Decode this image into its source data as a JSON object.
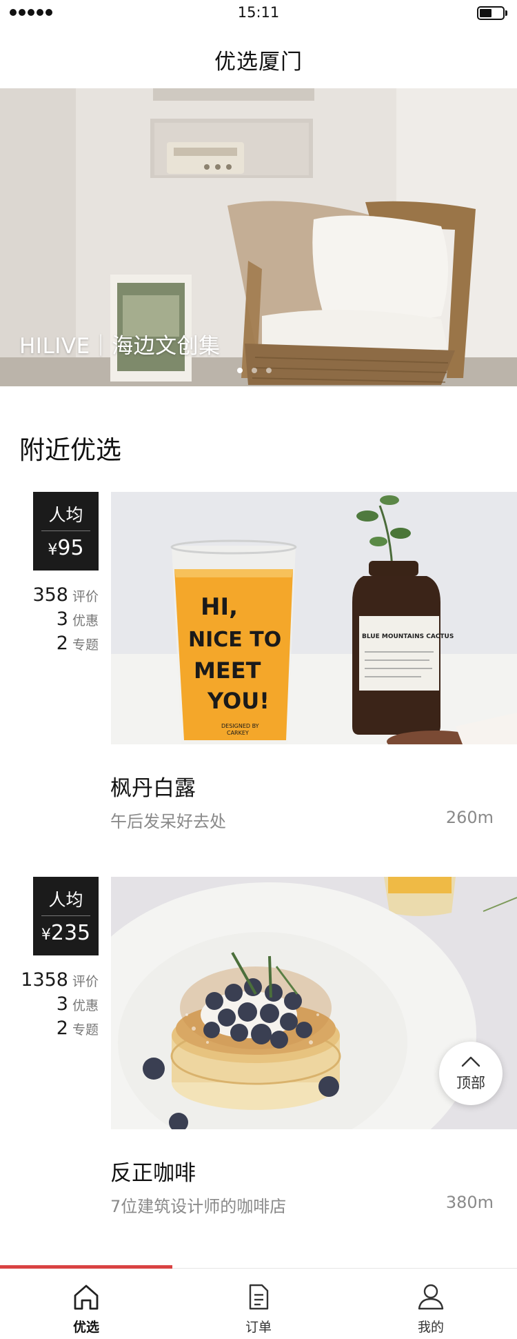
{
  "status_bar": {
    "time": "15:11"
  },
  "nav": {
    "title": "优选厦门"
  },
  "banner": {
    "caption": "HILIVE｜海边文创集",
    "slide_count": 3,
    "active_slide": 1
  },
  "section": {
    "title": "附近优选"
  },
  "cards": [
    {
      "avg_label": "人均",
      "currency": "¥",
      "price": "95",
      "stats": [
        {
          "value": "358",
          "unit": "评价"
        },
        {
          "value": "3",
          "unit": "优惠"
        },
        {
          "value": "2",
          "unit": "专题"
        }
      ],
      "name": "枫丹白露",
      "desc": "午后发呆好去处",
      "distance": "260m",
      "photo_text": {
        "line1": "HI,",
        "line2": "NICE TO",
        "line3": "MEET",
        "line4": "YOU!",
        "small": "DESIGNED BY",
        "small2": "CARKEY",
        "bottle": "BLUE MOUNTAINS CACTUS"
      }
    },
    {
      "avg_label": "人均",
      "currency": "¥",
      "price": "235",
      "stats": [
        {
          "value": "1358",
          "unit": "评价"
        },
        {
          "value": "3",
          "unit": "优惠"
        },
        {
          "value": "2",
          "unit": "专题"
        }
      ],
      "name": "反正咖啡",
      "desc": "7位建筑设计师的咖啡店",
      "distance": "380m"
    }
  ],
  "back_to_top": {
    "label": "顶部",
    "icon": "chevron-up-icon"
  },
  "tabs": [
    {
      "label": "优选",
      "icon": "home-icon",
      "active": true
    },
    {
      "label": "订单",
      "icon": "document-icon",
      "active": false
    },
    {
      "label": "我的",
      "icon": "user-icon",
      "active": false
    }
  ],
  "colors": {
    "accent": "#d94242",
    "badge_bg": "#1b1b1b",
    "muted_text": "#8a8a8a"
  }
}
